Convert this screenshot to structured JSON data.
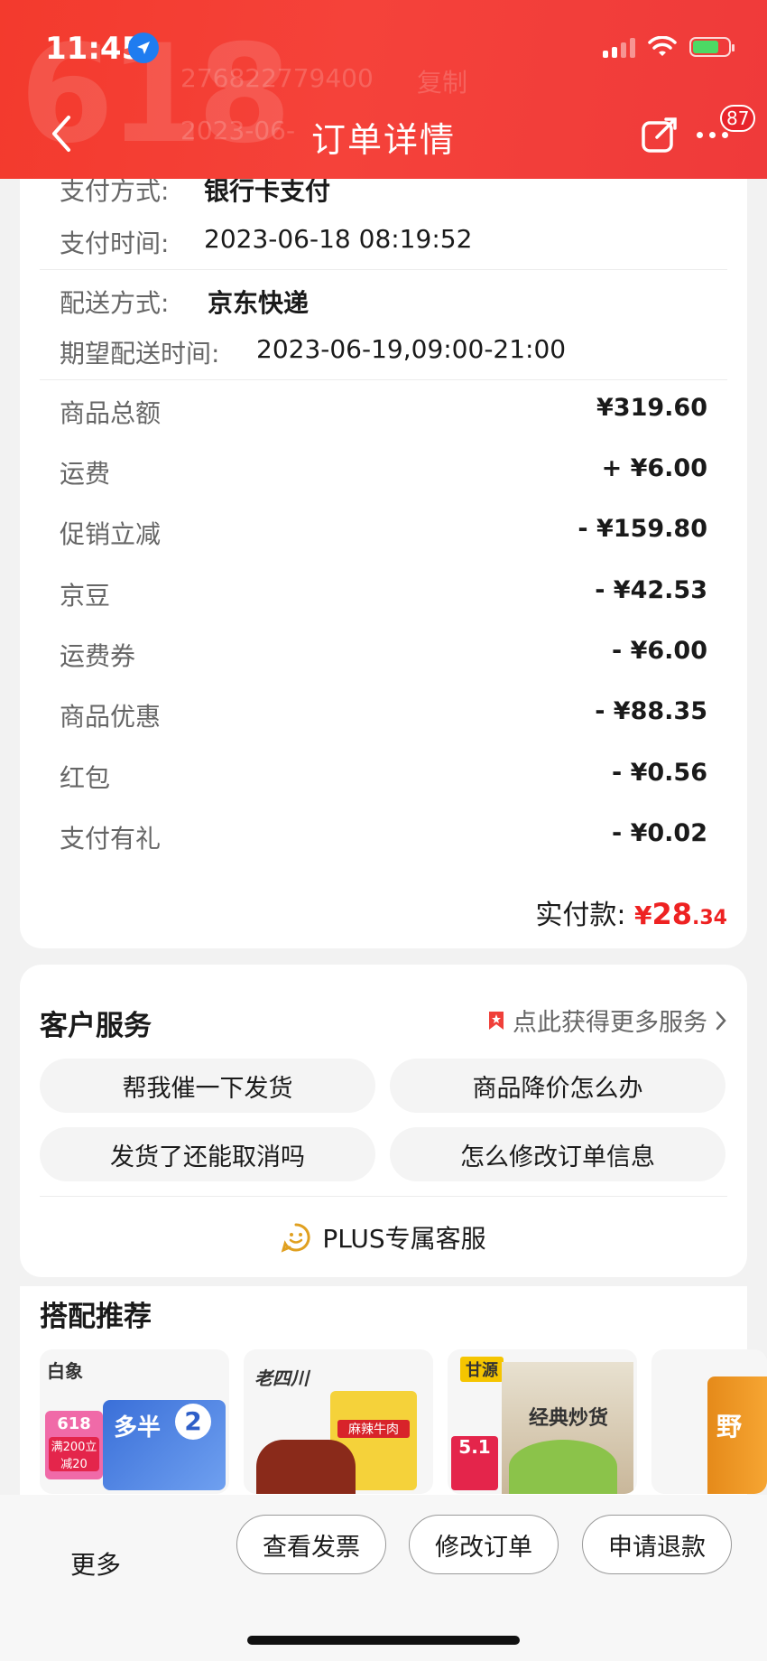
{
  "status": {
    "time": "11:45"
  },
  "header": {
    "title": "订单详情",
    "badge_count": "87",
    "background_order_no": "276822779400",
    "background_copy": "复制",
    "background_time": "2023-06-"
  },
  "order_info": {
    "payment_method_label": "支付方式:",
    "payment_method_value": "银行卡支付",
    "payment_time_label": "支付时间:",
    "payment_time_value": "2023-06-18 08:19:52",
    "delivery_label": "配送方式:",
    "delivery_value": "京东快递",
    "expected_label": "期望配送时间:",
    "expected_value": "2023-06-19,09:00-21:00"
  },
  "price_rows": [
    {
      "label": "商品总额",
      "amount": "¥319.60"
    },
    {
      "label": "运费",
      "amount": "+ ¥6.00"
    },
    {
      "label": "促销立减",
      "amount": "- ¥159.80"
    },
    {
      "label": "京豆",
      "amount": "- ¥42.53"
    },
    {
      "label": "运费券",
      "amount": "- ¥6.00"
    },
    {
      "label": "商品优惠",
      "amount": "- ¥88.35"
    },
    {
      "label": "红包",
      "amount": "- ¥0.56"
    },
    {
      "label": "支付有礼",
      "amount": "- ¥0.02"
    }
  ],
  "paid": {
    "label": "实付款:",
    "currency": "¥",
    "integer": "28",
    "decimal": ".34"
  },
  "service": {
    "title": "客户服务",
    "more_link": "点此获得更多服务",
    "chips": [
      "帮我催一下发货",
      "商品降价怎么办",
      "发货了还能取消吗",
      "怎么修改订单信息"
    ],
    "plus": "PLUS专属客服"
  },
  "recommend": {
    "title": "搭配推荐",
    "items": [
      {
        "brand": "白象",
        "tag": "618",
        "promo": "满200立减20",
        "name": "多半",
        "sub": "2"
      },
      {
        "brand": "老四川",
        "name": "麻辣牛肉"
      },
      {
        "brand": "甘源",
        "name": "经典炒货",
        "price": "5.1"
      },
      {
        "name": "野"
      }
    ]
  },
  "bottom": {
    "more": "更多",
    "buttons": [
      "查看发票",
      "修改订单",
      "申请退款"
    ]
  },
  "colors": {
    "header": "#f33a2d",
    "paid": "#ee2222",
    "badge": "#e8242b"
  }
}
